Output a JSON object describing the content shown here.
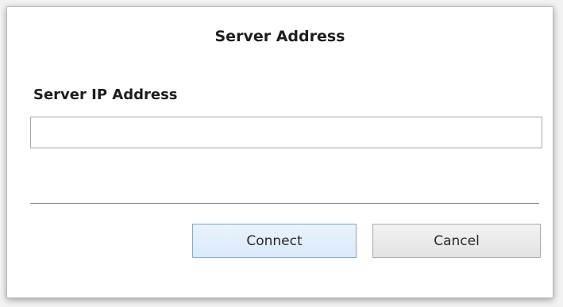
{
  "dialog": {
    "title": "Server Address",
    "field_label": "Server IP Address",
    "ip_value": "",
    "ip_placeholder": "",
    "buttons": {
      "connect_label": "Connect",
      "cancel_label": "Cancel"
    }
  }
}
